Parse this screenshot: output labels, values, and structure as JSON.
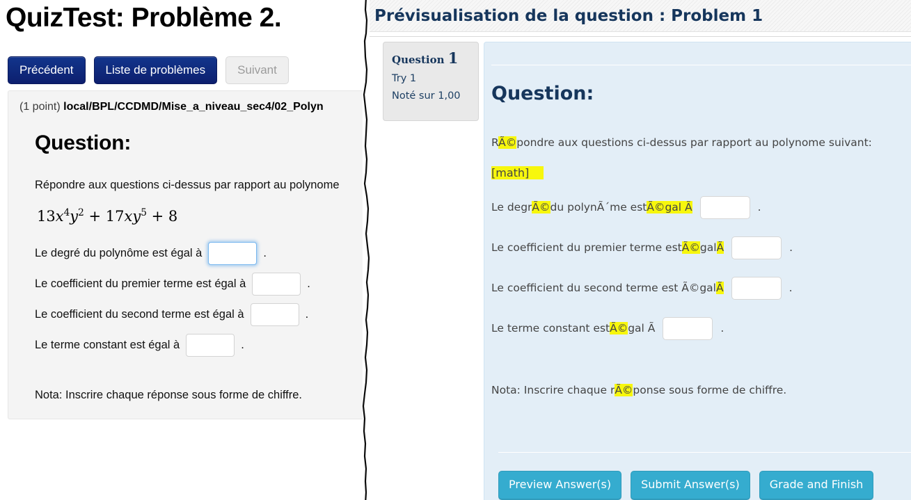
{
  "left": {
    "title": "QuizTest: Problème 2.",
    "nav": {
      "prev_label": "Précédent",
      "list_label": "Liste de problèmes",
      "next_label": "Suivant"
    },
    "point_prefix": "(1 point)",
    "problem_path": "local/BPL/CCDMD/Mise_a_niveau_sec4/02_Polyn",
    "question_heading": "Question:",
    "intro": "Répondre aux questions ci-dessus par rapport au polynome",
    "math_expression": "13x⁴y² + 17xy⁵ + 8",
    "rows": [
      {
        "label": "Le degré du polynôme est égal à",
        "value": "",
        "period": ".",
        "focused": true
      },
      {
        "label": "Le coefficient du premier terme est égal à",
        "value": "",
        "period": ".",
        "focused": false
      },
      {
        "label": "Le coefficient du second terme est égal à",
        "value": "",
        "period": ".",
        "focused": false
      },
      {
        "label": "Le terme constant est égal à",
        "value": "",
        "period": ".",
        "focused": false
      }
    ],
    "nota": "Nota: Inscrire chaque réponse sous forme de chiffre."
  },
  "right": {
    "header_title": "Prévisualisation de la question : Problem 1",
    "qinfo": {
      "question_word": "Question",
      "question_number": "1",
      "try_label": "Try 1",
      "grade_label": "Noté sur 1,00"
    },
    "question_heading": "Question:",
    "intro_parts": [
      {
        "text": "R",
        "highlight": false
      },
      {
        "text": "Ã©",
        "highlight": true
      },
      {
        "text": "pondre aux questions ci-dessus par rapport au polynome suivant:",
        "highlight": false
      }
    ],
    "math_placeholder": "[math]",
    "rows": [
      {
        "parts": [
          {
            "text": "Le degr",
            "highlight": false
          },
          {
            "text": "Ã©",
            "highlight": true
          },
          {
            "text": " du polynÃ´me est ",
            "highlight": false
          },
          {
            "text": "Ã©gal Ã",
            "highlight": true
          }
        ],
        "value": "",
        "period": "."
      },
      {
        "parts": [
          {
            "text": "Le coefficient du premier terme est ",
            "highlight": false
          },
          {
            "text": "Ã©",
            "highlight": true
          },
          {
            "text": "gal ",
            "highlight": false
          },
          {
            "text": "Ã",
            "highlight": true
          }
        ],
        "value": "",
        "period": "."
      },
      {
        "parts": [
          {
            "text": "Le coefficient du second terme est Ã©gal ",
            "highlight": false
          },
          {
            "text": "Ã",
            "highlight": true
          }
        ],
        "value": "",
        "period": "."
      },
      {
        "parts": [
          {
            "text": "Le terme constant est ",
            "highlight": false
          },
          {
            "text": "Ã©",
            "highlight": true
          },
          {
            "text": "gal Ã",
            "highlight": false
          }
        ],
        "value": "",
        "period": "."
      }
    ],
    "nota_parts": [
      {
        "text": "Nota: Inscrire chaque r",
        "highlight": false
      },
      {
        "text": "Ã©",
        "highlight": true
      },
      {
        "text": "ponse sous forme de chiffre.",
        "highlight": false
      }
    ],
    "buttons": [
      {
        "label": "Preview Answer(s)"
      },
      {
        "label": "Submit Answer(s)"
      },
      {
        "label": "Grade and Finish"
      }
    ]
  },
  "colors": {
    "nav_primary": "#12358c",
    "preview_title": "#16365c",
    "teal_button": "#35accf",
    "highlight": "#f7f70d",
    "question_panel_bg": "#e3eef7"
  }
}
